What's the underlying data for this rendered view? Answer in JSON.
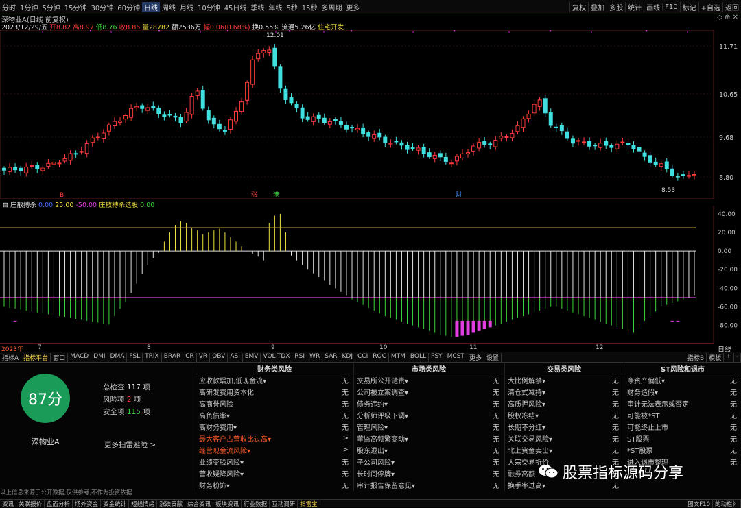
{
  "toolbar": {
    "left": [
      "分时",
      "1分钟",
      "5分钟",
      "15分钟",
      "30分钟",
      "60分钟",
      "日线",
      "周线",
      "月线",
      "10分钟",
      "45日线",
      "季线",
      "年线",
      "5秒",
      "15秒",
      "多周期",
      "更多"
    ],
    "active_index": 6,
    "right": [
      "复权",
      "叠加",
      "多股",
      "统计",
      "画线",
      "F10",
      "标记",
      "+自选",
      "返回"
    ]
  },
  "chart": {
    "title": "深物业A(日线 前复权)",
    "ohlc": {
      "date": "2023/12/29/五",
      "open_label": "开",
      "open": "8.82",
      "high_label": "高",
      "high": "8.97",
      "low_label": "低",
      "low": "8.76",
      "close_label": "收",
      "close": "8.86",
      "vol_label": "量",
      "vol": "28782",
      "amt_label": "额",
      "amt": "2536万",
      "chg_label": "幅",
      "chg": "0.06(0.68%)",
      "turn_label": "换",
      "turn": "0.55%",
      "float_label": "流通",
      "float": "5.26亿",
      "sector": "住宅开发"
    },
    "price_axis": [
      "11.71",
      "10.65",
      "9.68",
      "8.80"
    ],
    "high_marker": "12.01",
    "low_marker": "8.53",
    "event_markers": [
      "B",
      "涨",
      "港",
      "财"
    ],
    "months": [
      "2023年",
      "7",
      "8",
      "9",
      "10",
      "11",
      "12"
    ],
    "period_label": "日线"
  },
  "indicator": {
    "name": "庄散搏杀",
    "params": [
      "0.00",
      "25.00",
      "-50.00"
    ],
    "sub_name": "庄散搏杀选股",
    "sub_value": "0.00",
    "axis": [
      "40.00",
      "20.00",
      "0.00",
      "-20.00",
      "-40.00",
      "-60.00",
      "-80.00"
    ]
  },
  "chart_data": {
    "type": "bar",
    "title": "庄散搏杀",
    "ylim": [
      -95,
      45
    ],
    "reference_lines": [
      25,
      0,
      -50
    ],
    "categories_count": 126,
    "values": [
      -60,
      -61,
      -62,
      -63,
      -64,
      -65,
      -66,
      -67,
      -68,
      -69,
      -70,
      -71,
      -72,
      -73,
      -74,
      -75,
      -76,
      -77,
      -78,
      -79,
      -70,
      -62,
      -55,
      -45,
      -35,
      -25,
      -15,
      -8,
      -2,
      10,
      20,
      28,
      32,
      30,
      25,
      22,
      18,
      20,
      22,
      24,
      20,
      15,
      10,
      5,
      0,
      -3,
      -6,
      -10,
      30,
      38,
      40,
      20,
      -5,
      -10,
      -15,
      -20,
      -24,
      -28,
      -32,
      -36,
      -40,
      -44,
      -48,
      -52,
      -55,
      -58,
      -61,
      -64,
      -67,
      -70,
      -72,
      -74,
      -76,
      -78,
      -80,
      -82,
      -84,
      -86,
      -88,
      -90,
      -91,
      -92,
      -92,
      -91,
      -90,
      -88,
      -86,
      -84,
      -82,
      -80,
      -78,
      -76,
      -74,
      -72,
      -70,
      -68,
      -66,
      -64,
      -62,
      -60,
      -60,
      -62,
      -64,
      -66,
      -68,
      -70,
      -72,
      -74,
      -76,
      -78,
      -80,
      -82,
      -84,
      -86,
      -88,
      -80,
      -75,
      -70,
      -65,
      -60,
      -58,
      -56,
      -54,
      -52,
      -50,
      -48
    ],
    "highlight_range": [
      [
        2,
        2
      ],
      [
        82,
        88
      ],
      [
        121,
        122
      ]
    ]
  },
  "tabs": {
    "items": [
      "指标A",
      "指标平台",
      "窗口",
      "MACD",
      "DMI",
      "DMA",
      "FSL",
      "TRIX",
      "BRAR",
      "CR",
      "VR",
      "OBV",
      "ASI",
      "EMV",
      "VOL-TDX",
      "RSI",
      "WR",
      "SAR",
      "KDJ",
      "CCI",
      "ROC",
      "MTM",
      "BOLL",
      "PSY",
      "MCST",
      "更多",
      "设置"
    ],
    "right": [
      "指标B",
      "模板",
      "+",
      "-"
    ]
  },
  "risk": {
    "score": "87分",
    "stock": "深物业A",
    "total_label": "总检查",
    "total": "117",
    "unit": "项",
    "risk_label": "风险项",
    "risk": "2",
    "safe_label": "安全项",
    "safe": "115",
    "more": "更多扫雷避险 >",
    "disclaimer": "以上信息来源于公开数据,仅供参考,不作为投资依据",
    "columns": [
      {
        "header": "财务类风险",
        "rows": [
          {
            "k": "应收款增加,低现金流▾",
            "v": "无",
            "warn": false
          },
          {
            "k": "高研发费用资本化",
            "v": "无",
            "warn": false
          },
          {
            "k": "高商誉风险",
            "v": "无",
            "warn": false
          },
          {
            "k": "高负债率▾",
            "v": "无",
            "warn": false
          },
          {
            "k": "高财务费用▾",
            "v": "无",
            "warn": false
          },
          {
            "k": "最大客户占营收比过高▾",
            "v": ">",
            "warn": true
          },
          {
            "k": "经营现金流风险▾",
            "v": ">",
            "warn": true
          },
          {
            "k": "业绩变脸风险▾",
            "v": "无",
            "warn": false
          },
          {
            "k": "营收疑降风险▾",
            "v": "无",
            "warn": false
          },
          {
            "k": "财务粉饰▾",
            "v": "无",
            "warn": false
          }
        ]
      },
      {
        "header": "市场类风险",
        "rows": [
          {
            "k": "交易所公开谴责▾",
            "v": "无",
            "warn": false
          },
          {
            "k": "公司被立案调查▾",
            "v": "无",
            "warn": false
          },
          {
            "k": "债务违约▾",
            "v": "无",
            "warn": false
          },
          {
            "k": "分析师评级下调▾",
            "v": "无",
            "warn": false
          },
          {
            "k": "管理风险▾",
            "v": "无",
            "warn": false
          },
          {
            "k": "董监高频繁变动▾",
            "v": "无",
            "warn": false
          },
          {
            "k": "股东退出▾",
            "v": "无",
            "warn": false
          },
          {
            "k": "子公司风险▾",
            "v": "无",
            "warn": false
          },
          {
            "k": "长时间停牌▾",
            "v": "无",
            "warn": false
          },
          {
            "k": "审计报告保留意见▾",
            "v": "无",
            "warn": false
          }
        ]
      },
      {
        "header": "交易类风险",
        "rows": [
          {
            "k": "大比例解禁▾",
            "v": "无",
            "warn": false
          },
          {
            "k": "清仓式减持▾",
            "v": "无",
            "warn": false
          },
          {
            "k": "高质押风险▾",
            "v": "无",
            "warn": false
          },
          {
            "k": "股权冻结▾",
            "v": "无",
            "warn": false
          },
          {
            "k": "长期不分红▾",
            "v": "无",
            "warn": false
          },
          {
            "k": "关联交易风险▾",
            "v": "无",
            "warn": false
          },
          {
            "k": "北上资金卖出▾",
            "v": "无",
            "warn": false
          },
          {
            "k": "大宗交易折价",
            "v": "无",
            "warn": false
          },
          {
            "k": "融券高额",
            "v": "无",
            "warn": false
          },
          {
            "k": "换手率过高▾",
            "v": "无",
            "warn": false
          }
        ]
      },
      {
        "header": "ST风险和退市",
        "rows": [
          {
            "k": "净资产偏低▾",
            "v": "无",
            "warn": false
          },
          {
            "k": "财务造假▾",
            "v": "无",
            "warn": false
          },
          {
            "k": "审计无法表示或否定",
            "v": "无",
            "warn": false
          },
          {
            "k": "可能被*ST",
            "v": "无",
            "warn": false
          },
          {
            "k": "可能终止上市",
            "v": "无",
            "warn": false
          },
          {
            "k": "ST股票",
            "v": "无",
            "warn": false
          },
          {
            "k": "*ST股票",
            "v": "无",
            "warn": false
          },
          {
            "k": "进入退市整理",
            "v": "无",
            "warn": false
          }
        ]
      }
    ]
  },
  "footer": [
    "资讯",
    "关联报价",
    "盘面分析",
    "场外资金",
    "资金统计",
    "短线情绪",
    "涨跌贡献",
    "综合资讯",
    "板块资讯",
    "行业数据",
    "互动调研",
    "扫雷宝"
  ],
  "footer_right": [
    "图文F10",
    "的动栏》"
  ],
  "watermark": "股票指标源码分享",
  "colors": {
    "up": "#ff3b3b",
    "down": "#40e0e0",
    "accent": "#243a66",
    "score_bg": "#1a9c58",
    "magenta": "#e040e0",
    "green": "#3bd63b",
    "yellow": "#f0e040"
  }
}
